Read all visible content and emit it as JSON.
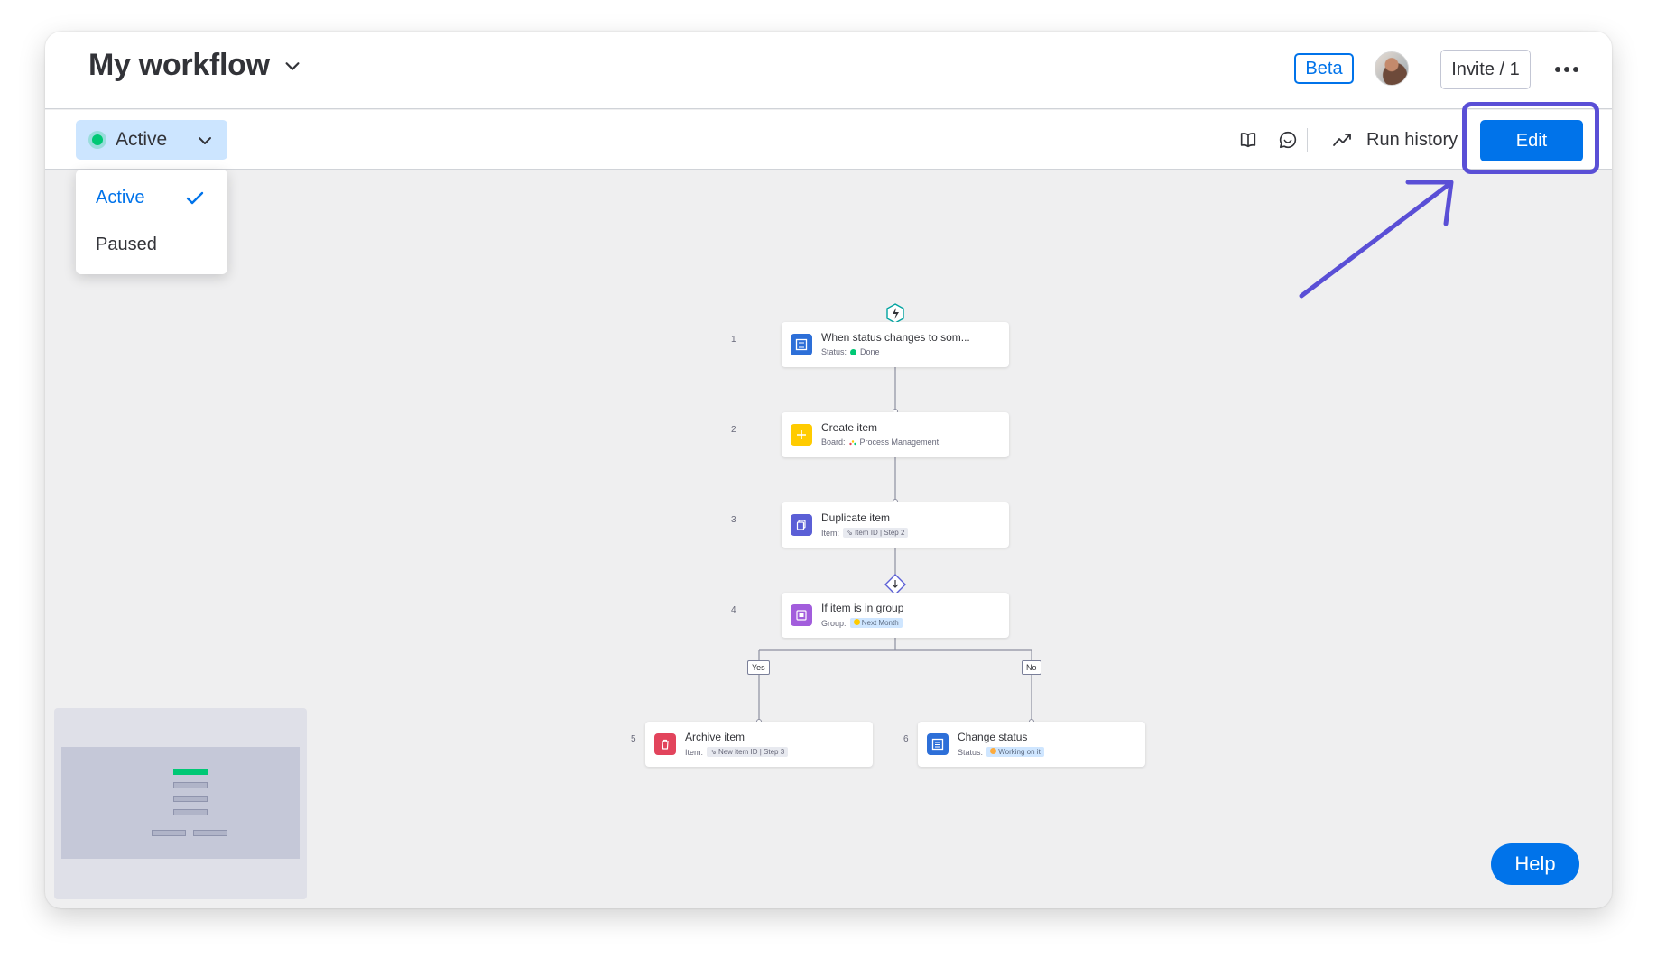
{
  "header": {
    "title": "My workflow",
    "beta_label": "Beta",
    "invite_label": "Invite / 1"
  },
  "toolbar": {
    "status_selected": "Active",
    "run_history_label": "Run history",
    "edit_label": "Edit"
  },
  "status_menu": {
    "options": [
      "Active",
      "Paused"
    ],
    "selected": "Active"
  },
  "workflow": {
    "nodes": [
      {
        "num": "1",
        "title": "When status changes to som...",
        "sub_label": "Status:",
        "sub_value": "Done",
        "dot_color": "#00c875",
        "icon": "status-column-icon",
        "icon_color": "#2d6fd8"
      },
      {
        "num": "2",
        "title": "Create item",
        "sub_label": "Board:",
        "sub_value": "Process Management",
        "icon": "plus-icon",
        "icon_color": "#ffcb00"
      },
      {
        "num": "3",
        "title": "Duplicate item",
        "sub_label": "Item:",
        "chips": [
          "Item ID",
          "Step 2"
        ],
        "icon": "duplicate-icon",
        "icon_color": "#5b5fd6"
      },
      {
        "num": "4",
        "title": "If item is in group",
        "sub_label": "Group:",
        "sub_value": "Next Month",
        "dot_color": "#ffcb00",
        "icon": "group-icon",
        "icon_color": "#a25ddc"
      },
      {
        "num": "5",
        "title": "Archive item",
        "sub_label": "Item:",
        "chips": [
          "New item ID",
          "Step 3"
        ],
        "icon": "trash-icon",
        "icon_color": "#e2445c"
      },
      {
        "num": "6",
        "title": "Change status",
        "sub_label": "Status:",
        "sub_value": "Working on it",
        "dot_color": "#fdab3d",
        "icon": "status-column-icon",
        "icon_color": "#2d6fd8"
      }
    ],
    "branch_yes": "Yes",
    "branch_no": "No"
  },
  "help_label": "Help",
  "colors": {
    "accent": "#0073ea",
    "annotation": "#5a4fd6",
    "active_green": "#00c875"
  }
}
